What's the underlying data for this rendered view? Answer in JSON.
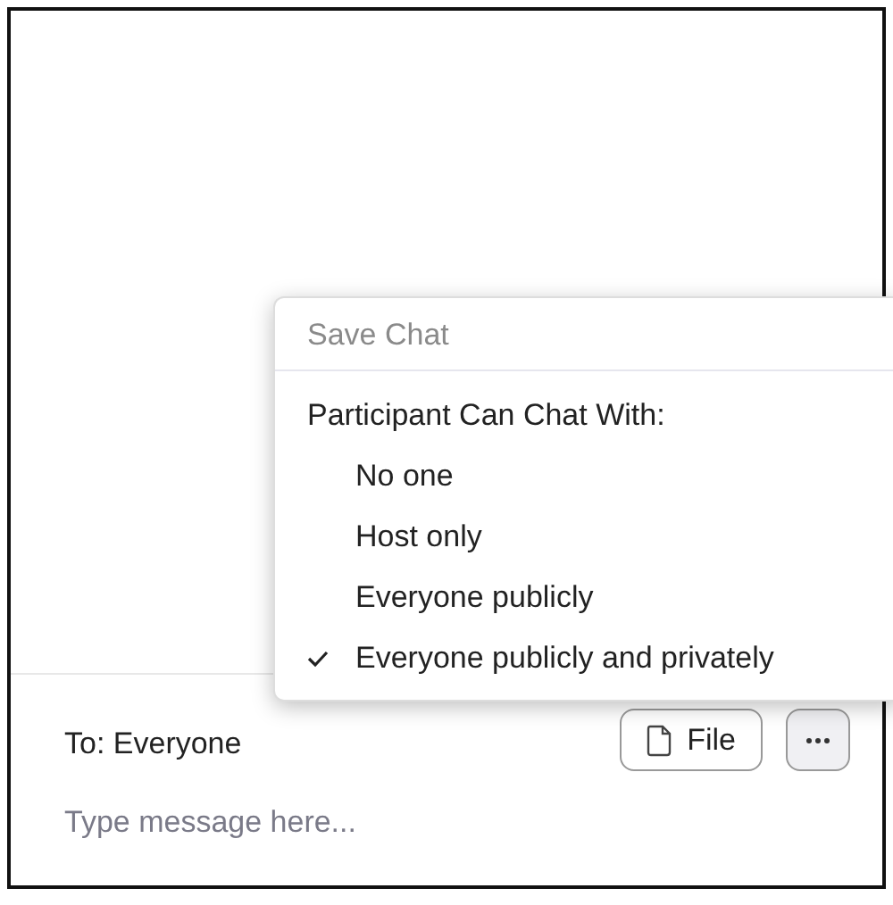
{
  "menu": {
    "save_chat": {
      "label": "Save Chat",
      "disabled": true
    },
    "section_title": "Participant Can Chat With:",
    "options": [
      {
        "label": "No one",
        "selected": false
      },
      {
        "label": "Host only",
        "selected": false
      },
      {
        "label": "Everyone publicly",
        "selected": false
      },
      {
        "label": "Everyone publicly and privately",
        "selected": true
      }
    ]
  },
  "composer": {
    "recipient": "To: Everyone",
    "file_button": "File",
    "message": {
      "placeholder": "Type message here..."
    }
  }
}
